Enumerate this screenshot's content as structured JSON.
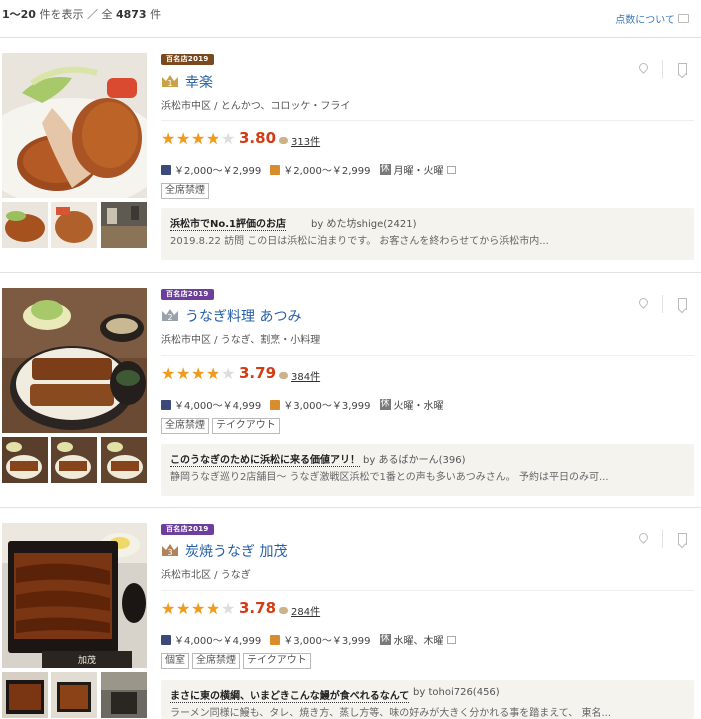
{
  "header": {
    "result_range": "1〜20",
    "result_mid": " 件を表示 ／ 全 ",
    "total": "4873",
    "result_suffix": " 件",
    "score_help": "点数について"
  },
  "listings": [
    {
      "badge": "百名店2019",
      "badge_color": "#7a4a1e",
      "rank": "1",
      "name": "幸楽",
      "area": "浜松市中区 / とんかつ、コロッケ・フライ",
      "rating": "3.80",
      "rating_value": 3.8,
      "review_count": "313件",
      "dinner_price": "￥2,000～￥2,999",
      "lunch_price": "￥2,000～￥2,999",
      "holiday_icon": "休",
      "holiday": "月曜・火曜",
      "tags": [
        "全席禁煙"
      ],
      "review_title": "浜松市でNo.1評価のお店",
      "review_by": "by めた坊shige(2421)",
      "review_body": "2019.8.22 訪問 この日は浜松に泊まりです。 お客さんを終わらせてから浜松市内..."
    },
    {
      "badge": "百名店2019",
      "badge_color": "#6d3f9c",
      "rank": "2",
      "name": "うなぎ料理 あつみ",
      "area": "浜松市中区 / うなぎ、割烹・小料理",
      "rating": "3.79",
      "rating_value": 3.79,
      "review_count": "384件",
      "dinner_price": "￥4,000～￥4,999",
      "lunch_price": "￥3,000～￥3,999",
      "holiday_icon": "休",
      "holiday": "火曜・水曜",
      "tags": [
        "全席禁煙",
        "テイクアウト"
      ],
      "review_title": "このうなぎのために浜松に来る価値アリ！",
      "review_by": "by あるばかーん(396)",
      "review_body": "静岡うなぎ巡り2店舗目〜 うなぎ激戦区浜松で1番との声も多いあつみさん。 予約は平日のみ可..."
    },
    {
      "badge": "百名店2019",
      "badge_color": "#6d3f9c",
      "rank": "3",
      "name": "炭焼うなぎ 加茂",
      "area": "浜松市北区 / うなぎ",
      "rating": "3.78",
      "rating_value": 3.78,
      "review_count": "284件",
      "dinner_price": "￥4,000～￥4,999",
      "lunch_price": "￥3,000～￥3,999",
      "holiday_icon": "休",
      "holiday": "水曜、木曜",
      "tags": [
        "個室",
        "全席禁煙",
        "テイクアウト"
      ],
      "review_title": "まさに東の横綱、いまどきこんな鰻が食べれるなんて",
      "review_by": "by tohoi726(456)",
      "review_body": "ラーメン同様に鰻も、タレ、焼き方、蒸し方等、味の好みが大きく分かれる事を踏まえて、 東名..."
    }
  ]
}
